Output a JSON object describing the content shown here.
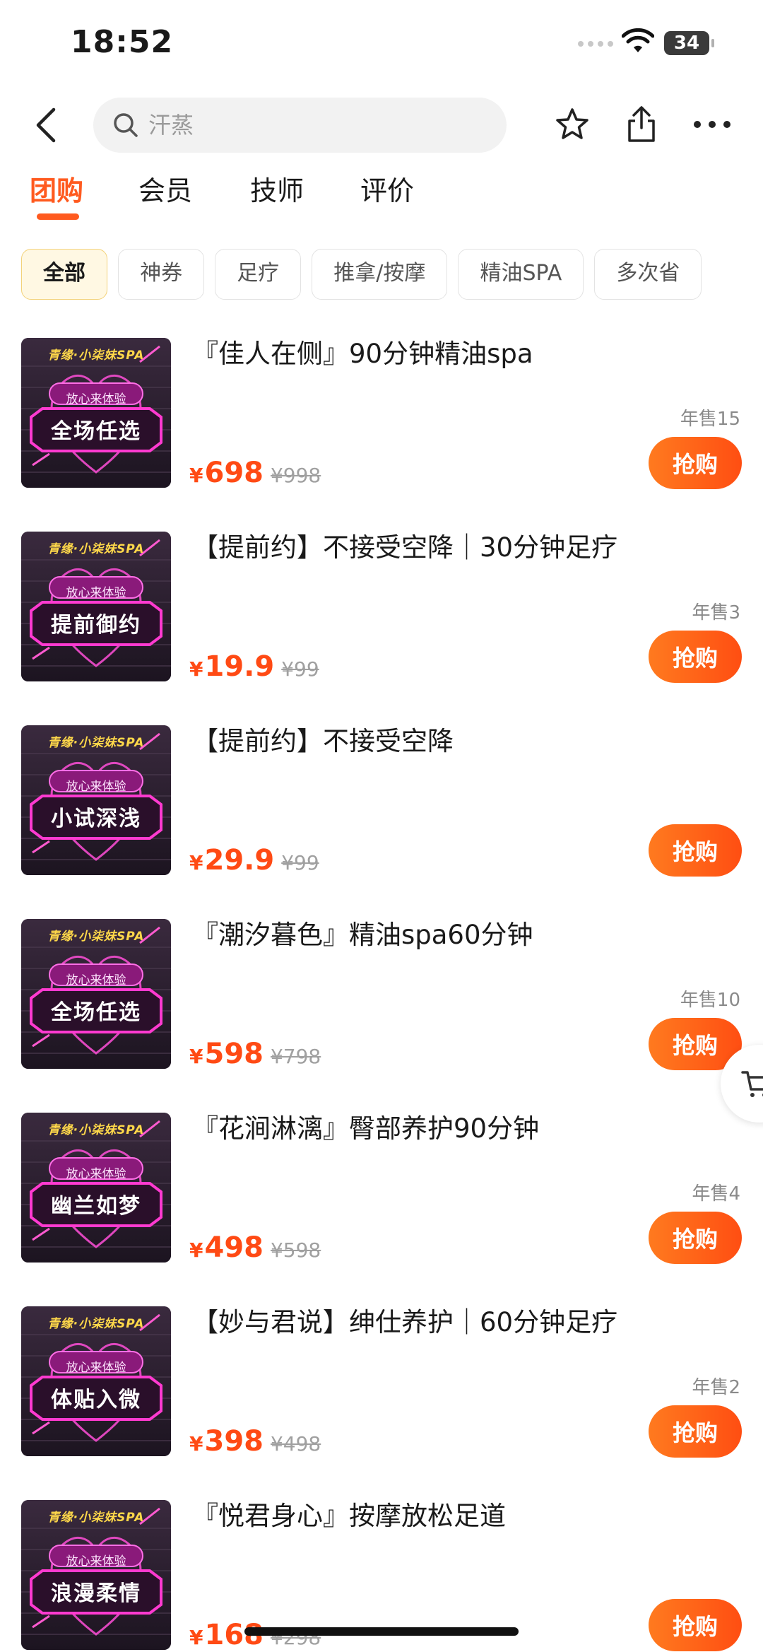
{
  "status_bar": {
    "time": "18:52",
    "battery": "34"
  },
  "nav": {
    "search_placeholder": "汗蒸"
  },
  "tabs": [
    {
      "label": "团购",
      "active": true
    },
    {
      "label": "会员",
      "active": false
    },
    {
      "label": "技师",
      "active": false
    },
    {
      "label": "评价",
      "active": false
    }
  ],
  "chips": [
    {
      "label": "全部",
      "active": true
    },
    {
      "label": "神券",
      "active": false
    },
    {
      "label": "足疗",
      "active": false
    },
    {
      "label": "推拿/按摩",
      "active": false
    },
    {
      "label": "精油SPA",
      "active": false
    },
    {
      "label": "多次省",
      "active": false
    }
  ],
  "thumb_common": {
    "brand": "青缘·小柒妹SPA",
    "sub": "放心来体验"
  },
  "items": [
    {
      "title": "『佳人在侧』90分钟精油spa",
      "thumb_label": "全场任选",
      "sales": "年售15",
      "price_symbol": "¥",
      "price": "698",
      "original_price": "¥998",
      "buy_label": "抢购"
    },
    {
      "title": "【提前约】不接受空降｜30分钟足疗",
      "thumb_label": "提前御约",
      "sales": "年售3",
      "price_symbol": "¥",
      "price": "19.9",
      "original_price": "¥99",
      "buy_label": "抢购"
    },
    {
      "title": "【提前约】不接受空降",
      "thumb_label": "小试深浅",
      "sales": "",
      "price_symbol": "¥",
      "price": "29.9",
      "original_price": "¥99",
      "buy_label": "抢购"
    },
    {
      "title": "『潮汐暮色』精油spa60分钟",
      "thumb_label": "全场任选",
      "sales": "年售10",
      "price_symbol": "¥",
      "price": "598",
      "original_price": "¥798",
      "buy_label": "抢购"
    },
    {
      "title": "『花涧淋漓』臀部养护90分钟",
      "thumb_label": "幽兰如梦",
      "sales": "年售4",
      "price_symbol": "¥",
      "price": "498",
      "original_price": "¥598",
      "buy_label": "抢购"
    },
    {
      "title": "【妙与君说】绅仕养护｜60分钟足疗",
      "thumb_label": "体贴入微",
      "sales": "年售2",
      "price_symbol": "¥",
      "price": "398",
      "original_price": "¥498",
      "buy_label": "抢购"
    },
    {
      "title": "『悦君身心』按摩放松足道",
      "thumb_label": "浪漫柔情",
      "sales": "",
      "price_symbol": "¥",
      "price": "168",
      "original_price": "¥298",
      "buy_label": "抢购"
    }
  ],
  "colors": {
    "accent": "#ff5a1f",
    "price": "#ff4a14",
    "chip_active_bg": "#fff8e3"
  }
}
